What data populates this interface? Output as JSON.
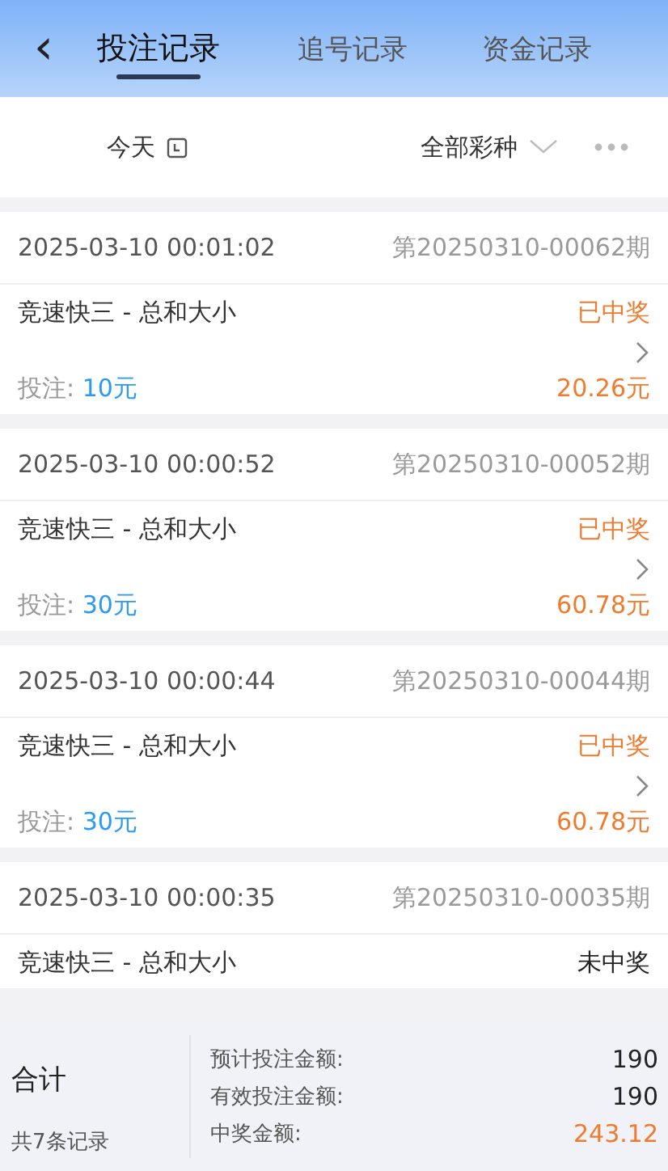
{
  "header": {
    "back": "‹",
    "tabs": [
      {
        "label": "投注记录",
        "selected": true
      },
      {
        "label": "追号记录",
        "selected": false
      },
      {
        "label": "资金记录",
        "selected": false
      }
    ]
  },
  "filters": {
    "date": "今天",
    "lottery": "全部彩种"
  },
  "records": [
    {
      "time": "2025-03-10 00:01:02",
      "period": "第20250310-00062期",
      "game": "竞速快三 - 总和大小",
      "status": "已中奖",
      "won": true,
      "stake_label": "投注:",
      "stake": "10元",
      "payout": "20.26元"
    },
    {
      "time": "2025-03-10 00:00:52",
      "period": "第20250310-00052期",
      "game": "竞速快三 - 总和大小",
      "status": "已中奖",
      "won": true,
      "stake_label": "投注:",
      "stake": "30元",
      "payout": "60.78元"
    },
    {
      "time": "2025-03-10 00:00:44",
      "period": "第20250310-00044期",
      "game": "竞速快三 - 总和大小",
      "status": "已中奖",
      "won": true,
      "stake_label": "投注:",
      "stake": "30元",
      "payout": "60.78元"
    },
    {
      "time": "2025-03-10 00:00:35",
      "period": "第20250310-00035期",
      "game": "竞速快三 - 总和大小",
      "status": "未中奖",
      "won": false
    }
  ],
  "summary": {
    "title": "合计",
    "count": "共7条记录",
    "lines": [
      {
        "label": "预计投注金额:",
        "value": "190",
        "highlight": false
      },
      {
        "label": "有效投注金额:",
        "value": "190",
        "highlight": false
      },
      {
        "label": "中奖金额:",
        "value": "243.12",
        "highlight": true
      }
    ]
  }
}
